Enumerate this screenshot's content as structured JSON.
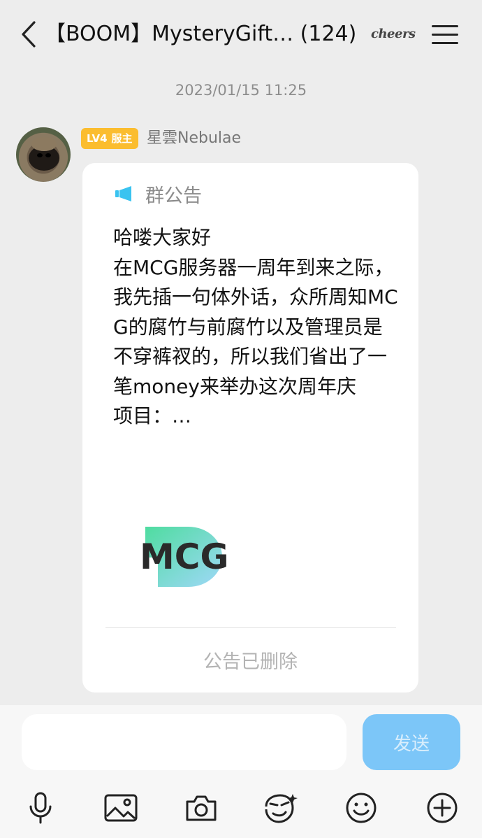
{
  "header": {
    "title": "【BOOM】MysteryGift…",
    "member_count": "(124)",
    "sticker_text": "cheers"
  },
  "chat": {
    "timestamp": "2023/01/15 11:25",
    "message": {
      "badge_level": "LV4",
      "badge_role": "服主",
      "sender_name": "星雲Nebulae",
      "notice_label": "群公告",
      "notice_text": "哈喽大家好\n在MCG服务器一周年到来之际，我先插一句体外话，众所周知MCG的腐竹与前腐竹以及管理员是不穿裤衩的，所以我们省出了一笔money来举办这次周年庆\n项目：…",
      "logo_text": "MCG",
      "status": "公告已删除"
    }
  },
  "composer": {
    "input_value": "",
    "send_label": "发送"
  },
  "colors": {
    "accent": "#7cc6f8",
    "badge": "#fbbd2f",
    "logo_green": "#4fdca0",
    "logo_blue": "#9fd8f8"
  },
  "toolbar": {
    "icons": [
      "microphone-icon",
      "image-icon",
      "camera-icon",
      "sticker-icon",
      "emoji-icon",
      "plus-icon"
    ]
  }
}
